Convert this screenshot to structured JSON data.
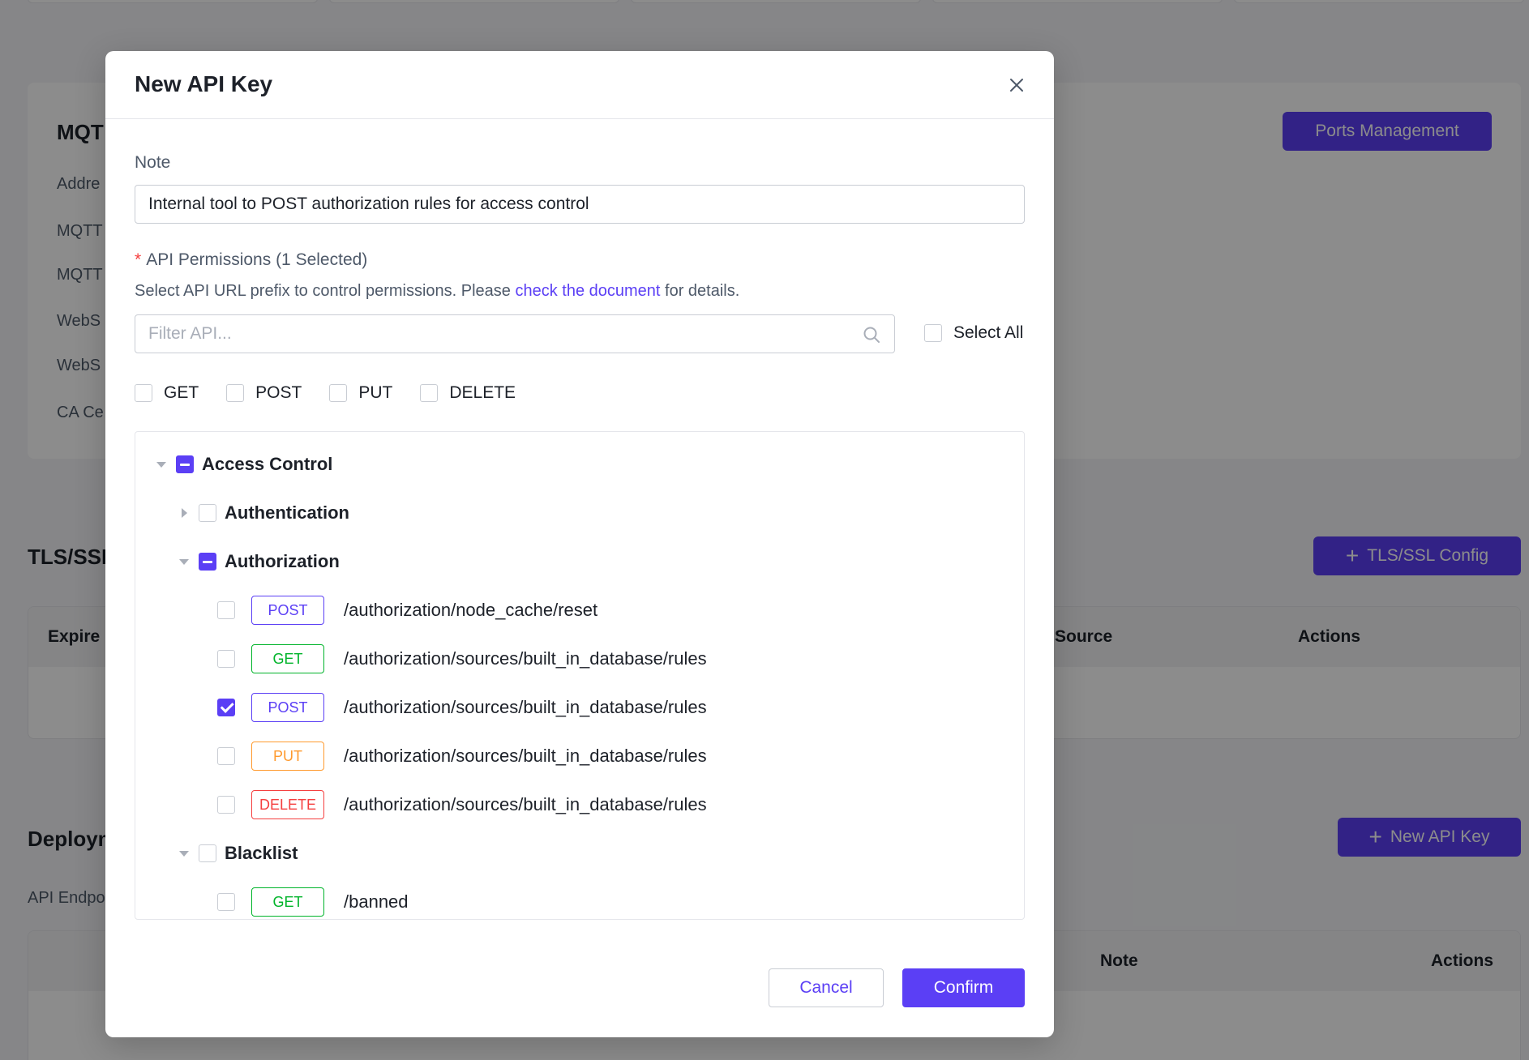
{
  "background": {
    "mqtt_heading": "MQT",
    "labels": [
      "Addre",
      "MQTT",
      "MQTT",
      "WebS",
      "WebS",
      "CA Ce"
    ],
    "ports_button": "Ports Management",
    "tls_heading": "TLS/SSI",
    "tls_button": "TLS/SSL Config",
    "tls_table_headers": [
      "Expire",
      "Source",
      "Actions"
    ],
    "deploy_heading": "Deploym",
    "api_endpoint_label": "API Endpo",
    "new_api_key_button": "New API Key",
    "api_table_headers": [
      "Note",
      "Actions"
    ]
  },
  "modal": {
    "title": "New API Key",
    "note_label": "Note",
    "note_value": "Internal tool to POST authorization rules for access control",
    "permissions_label": "API Permissions (1 Selected)",
    "required_mark": "*",
    "help_prefix": "Select API URL prefix to control permissions. Please ",
    "help_link": "check the document",
    "help_suffix": " for details.",
    "filter_placeholder": "Filter API...",
    "select_all_label": "Select All",
    "methods": [
      "GET",
      "POST",
      "PUT",
      "DELETE"
    ],
    "tree": {
      "root": {
        "label": "Access Control",
        "state": "indeterminate",
        "expanded": true
      },
      "authentication": {
        "label": "Authentication",
        "state": "unchecked",
        "expanded": false
      },
      "authorization": {
        "label": "Authorization",
        "state": "indeterminate",
        "expanded": true,
        "items": [
          {
            "method": "POST",
            "path": "/authorization/node_cache/reset",
            "checked": false
          },
          {
            "method": "GET",
            "path": "/authorization/sources/built_in_database/rules",
            "checked": false
          },
          {
            "method": "POST",
            "path": "/authorization/sources/built_in_database/rules",
            "checked": true
          },
          {
            "method": "PUT",
            "path": "/authorization/sources/built_in_database/rules",
            "checked": false
          },
          {
            "method": "DELETE",
            "path": "/authorization/sources/built_in_database/rules",
            "checked": false
          }
        ]
      },
      "blacklist": {
        "label": "Blacklist",
        "state": "unchecked",
        "expanded": true,
        "items": [
          {
            "method": "GET",
            "path": "/banned",
            "checked": false
          }
        ]
      }
    },
    "method_colors": {
      "GET": "#00b42a",
      "POST": "#5b3ff5",
      "PUT": "#ff9a2e",
      "DELETE": "#f53f3f"
    },
    "cancel_label": "Cancel",
    "confirm_label": "Confirm"
  },
  "colors": {
    "accent": "#5b3ff5",
    "required": "#f53f3f"
  }
}
